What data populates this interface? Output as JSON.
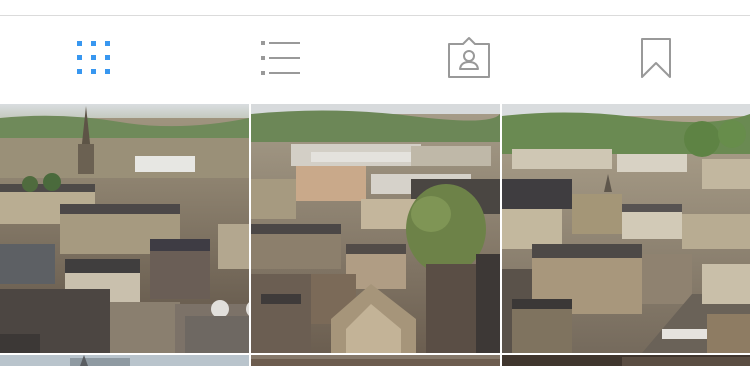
{
  "tabs": [
    {
      "id": "grid",
      "label": "Grid view",
      "icon": "grid-icon",
      "active": true
    },
    {
      "id": "list",
      "label": "List view",
      "icon": "list-icon",
      "active": false
    },
    {
      "id": "tagged",
      "label": "Photos of you",
      "icon": "tagged-person-icon",
      "active": false
    },
    {
      "id": "saved",
      "label": "Saved",
      "icon": "bookmark-icon",
      "active": false
    }
  ],
  "colors": {
    "active_tab": "#3897f0",
    "inactive_tab": "#999999",
    "divider": "#dbdbdb",
    "background": "#ffffff"
  },
  "grid": {
    "columns": 3,
    "photos": [
      {
        "alt": "Aerial view of Bath city rooftops with church spire"
      },
      {
        "alt": "Aerial view of Bath city center with tree in middle"
      },
      {
        "alt": "Aerial view of Bath rooftops and Roman Baths area"
      },
      {
        "alt": ""
      },
      {
        "alt": ""
      },
      {
        "alt": ""
      }
    ]
  }
}
